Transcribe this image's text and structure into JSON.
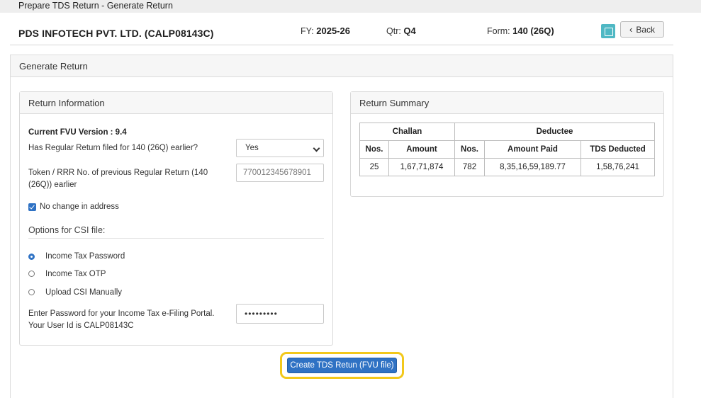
{
  "window": {
    "title": "Prepare TDS Return - Generate Return"
  },
  "header": {
    "company": "PDS INFOTECH PVT. LTD. (CALP08143C)",
    "fy_label": "FY:",
    "fy_value": "2025-26",
    "qtr_label": "Qtr:",
    "qtr_value": "Q4",
    "form_label": "Form:",
    "form_value": "140 (26Q)",
    "save_icon": "save-icon",
    "back_label": "Back"
  },
  "panel": {
    "title": "Generate Return"
  },
  "return_info": {
    "title": "Return Information",
    "fvu_version": "Current FVU Version : 9.4",
    "regular_filed_question": "Has Regular Return filed for 140 (26Q) earlier?",
    "regular_filed_value": "Yes",
    "token_label": "Token / RRR No. of previous Regular Return (140 (26Q)) earlier",
    "token_value": "770012345678901",
    "no_change_address": "No change in address",
    "csi_options_title": "Options for CSI file:",
    "csi_options": [
      "Income Tax Password",
      "Income Tax OTP",
      "Upload CSI Manually"
    ],
    "csi_selected": "Income Tax Password",
    "password_label": "Enter Password for your Income Tax e-Filing Portal. Your User Id is CALP08143C",
    "password_value": "•••••••••"
  },
  "return_summary": {
    "title": "Return Summary",
    "group_headers": [
      "Challan",
      "Deductee"
    ],
    "columns": [
      "Nos.",
      "Amount",
      "Nos.",
      "Amount Paid",
      "TDS Deducted"
    ],
    "rows": [
      [
        "25",
        "1,67,71,874",
        "782",
        "8,35,16,59,189.77",
        "1,58,76,241"
      ]
    ]
  },
  "actions": {
    "create_label": "Create TDS Retun (FVU file)"
  },
  "colors": {
    "primary": "#2f72c4",
    "highlight": "#f2c81b",
    "save_icon": "#4fb8c4"
  }
}
